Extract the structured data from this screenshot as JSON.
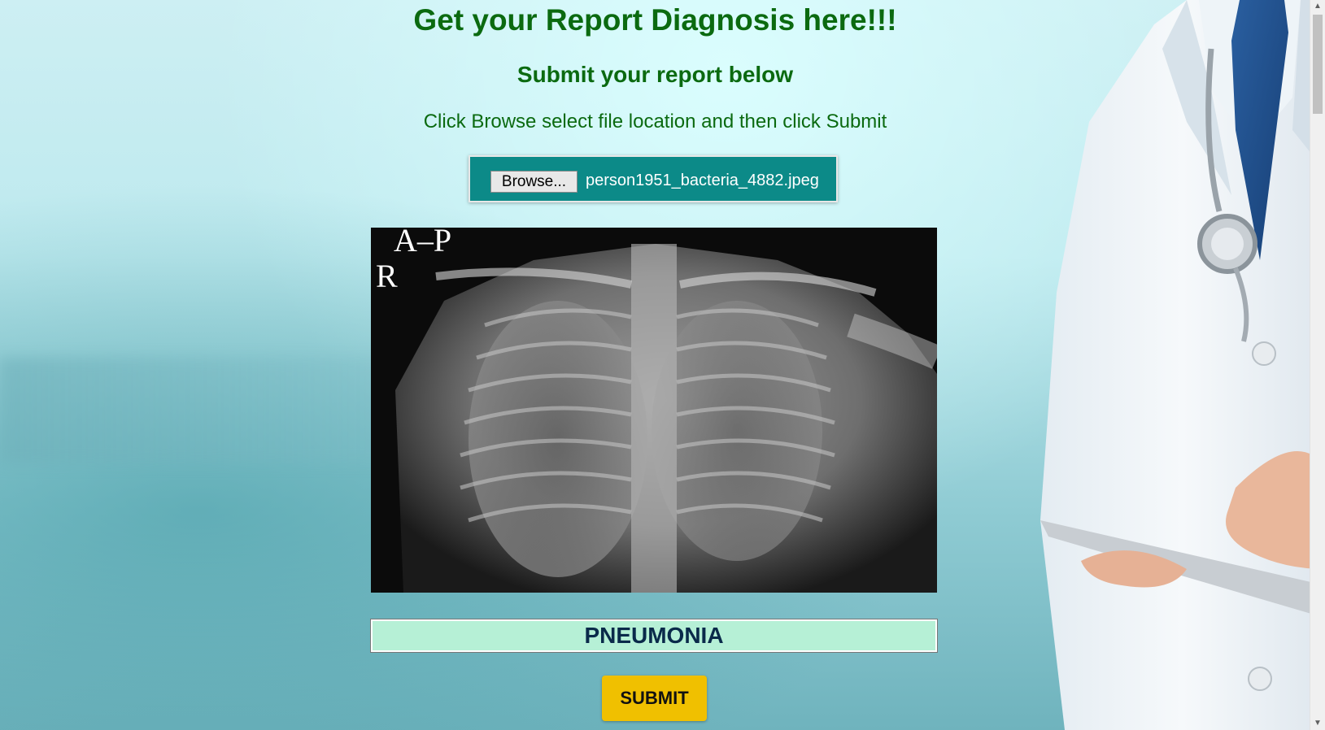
{
  "header": {
    "title": "Get your Report Diagnosis here!!!",
    "subtitle": "Submit your report below",
    "instruction": "Click Browse select file location and then click Submit"
  },
  "upload": {
    "browse_label": "Browse...",
    "file_name": "person1951_bacteria_4882.jpeg"
  },
  "xray_image": {
    "markers": [
      "A–P",
      "R"
    ]
  },
  "result": {
    "diagnosis": "PNEUMONIA"
  },
  "actions": {
    "submit_label": "SUBMIT"
  },
  "colors": {
    "heading": "#0b6a10",
    "upload_box": "#0c8a88",
    "result_bg": "#b6f0d6",
    "submit_bg": "#f0c000"
  }
}
